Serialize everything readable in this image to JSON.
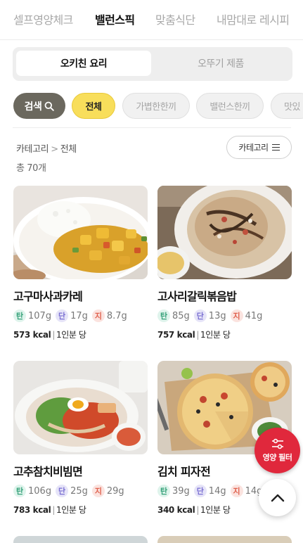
{
  "top_tabs": [
    {
      "label": "셀프영양체크",
      "active": false
    },
    {
      "label": "밸런스픽",
      "active": true
    },
    {
      "label": "맞춤식단",
      "active": false
    },
    {
      "label": "내맘대로 레시피",
      "active": false
    }
  ],
  "segment": {
    "active_label": "오키친 요리",
    "inactive_label": "오뚜기 제품"
  },
  "chips": {
    "search_label": "검색",
    "all_label": "전체",
    "items": [
      "가볍한한끼",
      "밸런스한끼",
      "맛있"
    ]
  },
  "breadcrumb": {
    "root": "카테고리",
    "separator": ">",
    "current": "전체"
  },
  "total_text": "총 70개",
  "category_button": "카테고리",
  "nutrition_labels": {
    "carb": "탄",
    "protein": "단",
    "fat": "지"
  },
  "recipes": [
    {
      "title": "고구마사과카레",
      "carb": "107g",
      "protein": "17g",
      "fat": "8.7g",
      "kcal": "573 kcal",
      "serving": "1인분 당"
    },
    {
      "title": "고사리갈릭볶음밥",
      "carb": "85g",
      "protein": "13g",
      "fat": "41g",
      "kcal": "757 kcal",
      "serving": "1인분 당"
    },
    {
      "title": "고추참치비빔면",
      "carb": "106g",
      "protein": "25g",
      "fat": "29g",
      "kcal": "783 kcal",
      "serving": "1인분 당"
    },
    {
      "title": "김치 피자전",
      "carb": "39g",
      "protein": "14g",
      "fat": "14g",
      "kcal": "340 kcal",
      "serving": "1인분 당"
    }
  ],
  "fab": {
    "filter_label": "영양 필터"
  },
  "colors": {
    "accent_red": "#e0283c",
    "chip_yellow": "#f8de5b",
    "search_chip": "#6b685e",
    "carb": "#37a27a",
    "protein": "#7a6fd2",
    "fat": "#e0624f"
  }
}
